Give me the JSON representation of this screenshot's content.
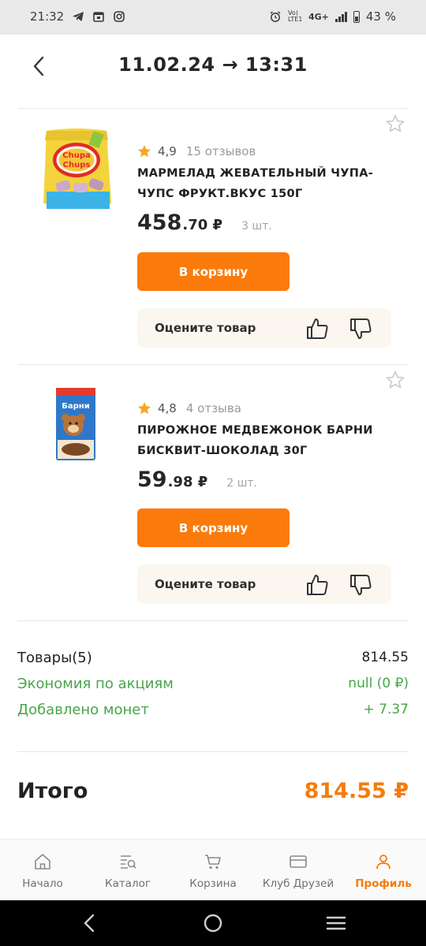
{
  "status_bar": {
    "time": "21:32",
    "network": "4G+",
    "volte": "Vo) LTE1",
    "battery": "43 %"
  },
  "header": {
    "title": "11.02.24 → 13:31",
    "back_icon": "chevron-left-icon"
  },
  "products": [
    {
      "rating": "4,9",
      "reviews": "15 отзывов",
      "name": "МАРМЕЛАД ЖЕВАТЕЛЬНЫЙ ЧУПА-ЧУПС ФРУКТ.ВКУС 150Г",
      "price_int": "458",
      "price_frac": ".70 ₽",
      "qty": "3 шт.",
      "cart_label": "В корзину",
      "rate_label": "Оцените товар",
      "image_text": "Chupa Chups"
    },
    {
      "rating": "4,8",
      "reviews": "4 отзыва",
      "name": "ПИРОЖНОЕ МЕДВЕЖОНОК БАРНИ БИСКВИТ-ШОКОЛАД 30Г",
      "price_int": "59",
      "price_frac": ".98 ₽",
      "qty": "2 шт.",
      "cart_label": "В корзину",
      "rate_label": "Оцените товар",
      "image_text": "Барни"
    }
  ],
  "summary": {
    "items_label": "Товары(5)",
    "items_value": "814.55",
    "savings_label": "Экономия по акциям",
    "savings_value": "null (0 ₽)",
    "coins_label": "Добавлено монет",
    "coins_value": "+ 7.37",
    "total_label": "Итого",
    "total_value": "814.55 ₽"
  },
  "bottom_nav": [
    {
      "label": "Начало",
      "icon": "home-icon",
      "active": false
    },
    {
      "label": "Каталог",
      "icon": "catalog-search-icon",
      "active": false
    },
    {
      "label": "Корзина",
      "icon": "cart-icon",
      "active": false
    },
    {
      "label": "Клуб Друзей",
      "icon": "card-icon",
      "active": false
    },
    {
      "label": "Профиль",
      "icon": "profile-icon",
      "active": true
    }
  ],
  "colors": {
    "accent": "#fa7b0c",
    "green": "#47a647",
    "star": "#f5a623"
  }
}
